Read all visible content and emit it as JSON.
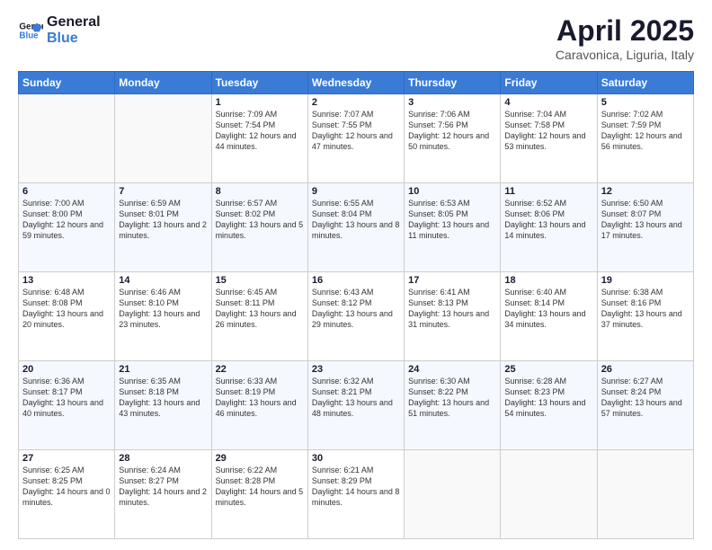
{
  "logo": {
    "line1": "General",
    "line2": "Blue"
  },
  "title": "April 2025",
  "subtitle": "Caravonica, Liguria, Italy",
  "days_of_week": [
    "Sunday",
    "Monday",
    "Tuesday",
    "Wednesday",
    "Thursday",
    "Friday",
    "Saturday"
  ],
  "weeks": [
    [
      {
        "day": "",
        "info": ""
      },
      {
        "day": "",
        "info": ""
      },
      {
        "day": "1",
        "info": "Sunrise: 7:09 AM\nSunset: 7:54 PM\nDaylight: 12 hours and 44 minutes."
      },
      {
        "day": "2",
        "info": "Sunrise: 7:07 AM\nSunset: 7:55 PM\nDaylight: 12 hours and 47 minutes."
      },
      {
        "day": "3",
        "info": "Sunrise: 7:06 AM\nSunset: 7:56 PM\nDaylight: 12 hours and 50 minutes."
      },
      {
        "day": "4",
        "info": "Sunrise: 7:04 AM\nSunset: 7:58 PM\nDaylight: 12 hours and 53 minutes."
      },
      {
        "day": "5",
        "info": "Sunrise: 7:02 AM\nSunset: 7:59 PM\nDaylight: 12 hours and 56 minutes."
      }
    ],
    [
      {
        "day": "6",
        "info": "Sunrise: 7:00 AM\nSunset: 8:00 PM\nDaylight: 12 hours and 59 minutes."
      },
      {
        "day": "7",
        "info": "Sunrise: 6:59 AM\nSunset: 8:01 PM\nDaylight: 13 hours and 2 minutes."
      },
      {
        "day": "8",
        "info": "Sunrise: 6:57 AM\nSunset: 8:02 PM\nDaylight: 13 hours and 5 minutes."
      },
      {
        "day": "9",
        "info": "Sunrise: 6:55 AM\nSunset: 8:04 PM\nDaylight: 13 hours and 8 minutes."
      },
      {
        "day": "10",
        "info": "Sunrise: 6:53 AM\nSunset: 8:05 PM\nDaylight: 13 hours and 11 minutes."
      },
      {
        "day": "11",
        "info": "Sunrise: 6:52 AM\nSunset: 8:06 PM\nDaylight: 13 hours and 14 minutes."
      },
      {
        "day": "12",
        "info": "Sunrise: 6:50 AM\nSunset: 8:07 PM\nDaylight: 13 hours and 17 minutes."
      }
    ],
    [
      {
        "day": "13",
        "info": "Sunrise: 6:48 AM\nSunset: 8:08 PM\nDaylight: 13 hours and 20 minutes."
      },
      {
        "day": "14",
        "info": "Sunrise: 6:46 AM\nSunset: 8:10 PM\nDaylight: 13 hours and 23 minutes."
      },
      {
        "day": "15",
        "info": "Sunrise: 6:45 AM\nSunset: 8:11 PM\nDaylight: 13 hours and 26 minutes."
      },
      {
        "day": "16",
        "info": "Sunrise: 6:43 AM\nSunset: 8:12 PM\nDaylight: 13 hours and 29 minutes."
      },
      {
        "day": "17",
        "info": "Sunrise: 6:41 AM\nSunset: 8:13 PM\nDaylight: 13 hours and 31 minutes."
      },
      {
        "day": "18",
        "info": "Sunrise: 6:40 AM\nSunset: 8:14 PM\nDaylight: 13 hours and 34 minutes."
      },
      {
        "day": "19",
        "info": "Sunrise: 6:38 AM\nSunset: 8:16 PM\nDaylight: 13 hours and 37 minutes."
      }
    ],
    [
      {
        "day": "20",
        "info": "Sunrise: 6:36 AM\nSunset: 8:17 PM\nDaylight: 13 hours and 40 minutes."
      },
      {
        "day": "21",
        "info": "Sunrise: 6:35 AM\nSunset: 8:18 PM\nDaylight: 13 hours and 43 minutes."
      },
      {
        "day": "22",
        "info": "Sunrise: 6:33 AM\nSunset: 8:19 PM\nDaylight: 13 hours and 46 minutes."
      },
      {
        "day": "23",
        "info": "Sunrise: 6:32 AM\nSunset: 8:21 PM\nDaylight: 13 hours and 48 minutes."
      },
      {
        "day": "24",
        "info": "Sunrise: 6:30 AM\nSunset: 8:22 PM\nDaylight: 13 hours and 51 minutes."
      },
      {
        "day": "25",
        "info": "Sunrise: 6:28 AM\nSunset: 8:23 PM\nDaylight: 13 hours and 54 minutes."
      },
      {
        "day": "26",
        "info": "Sunrise: 6:27 AM\nSunset: 8:24 PM\nDaylight: 13 hours and 57 minutes."
      }
    ],
    [
      {
        "day": "27",
        "info": "Sunrise: 6:25 AM\nSunset: 8:25 PM\nDaylight: 14 hours and 0 minutes."
      },
      {
        "day": "28",
        "info": "Sunrise: 6:24 AM\nSunset: 8:27 PM\nDaylight: 14 hours and 2 minutes."
      },
      {
        "day": "29",
        "info": "Sunrise: 6:22 AM\nSunset: 8:28 PM\nDaylight: 14 hours and 5 minutes."
      },
      {
        "day": "30",
        "info": "Sunrise: 6:21 AM\nSunset: 8:29 PM\nDaylight: 14 hours and 8 minutes."
      },
      {
        "day": "",
        "info": ""
      },
      {
        "day": "",
        "info": ""
      },
      {
        "day": "",
        "info": ""
      }
    ]
  ]
}
